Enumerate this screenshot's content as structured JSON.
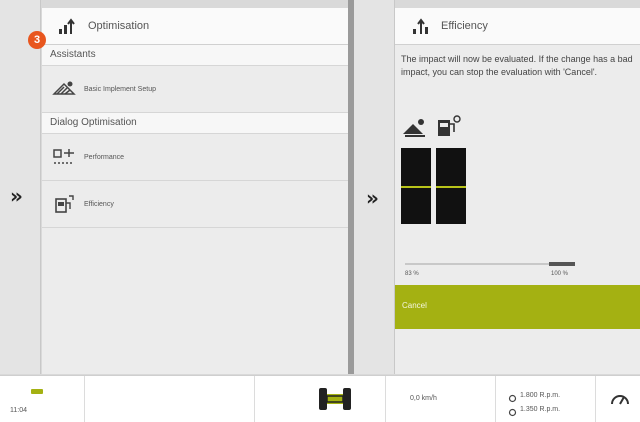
{
  "left_strip": {
    "expand_glyph": "»"
  },
  "optimisation_panel": {
    "title": "Optimisation",
    "step": "3",
    "sections": [
      {
        "label": "Assistants",
        "items": [
          {
            "label": "Basic Implement Setup",
            "icon": "implement-setup-icon"
          }
        ]
      },
      {
        "label": "Dialog Optimisation",
        "items": [
          {
            "label": "Performance",
            "icon": "performance-icon"
          },
          {
            "label": "Efficiency",
            "icon": "fuel-efficiency-icon"
          }
        ]
      }
    ]
  },
  "middle_strip": {
    "expand_glyph": "»"
  },
  "efficiency_panel": {
    "title": "Efficiency",
    "message": "The impact will now be evaluated. If the change has a bad impact, you can stop the evaluation with 'Cancel'.",
    "slider": {
      "min_label": "83 %",
      "max_label": "100 %",
      "value_fraction": 0.85
    },
    "gauges": {
      "left_level": 0.5,
      "right_level": 0.5
    },
    "cancel_label": "Cancel"
  },
  "status_bar": {
    "time": "11:04",
    "speed": "0,0 km/h",
    "rpm_primary": "1.800 R.p.m.",
    "rpm_secondary": "1.350 R.p.m."
  },
  "colors": {
    "accent": "#a4b112",
    "badge": "#e8561e"
  }
}
